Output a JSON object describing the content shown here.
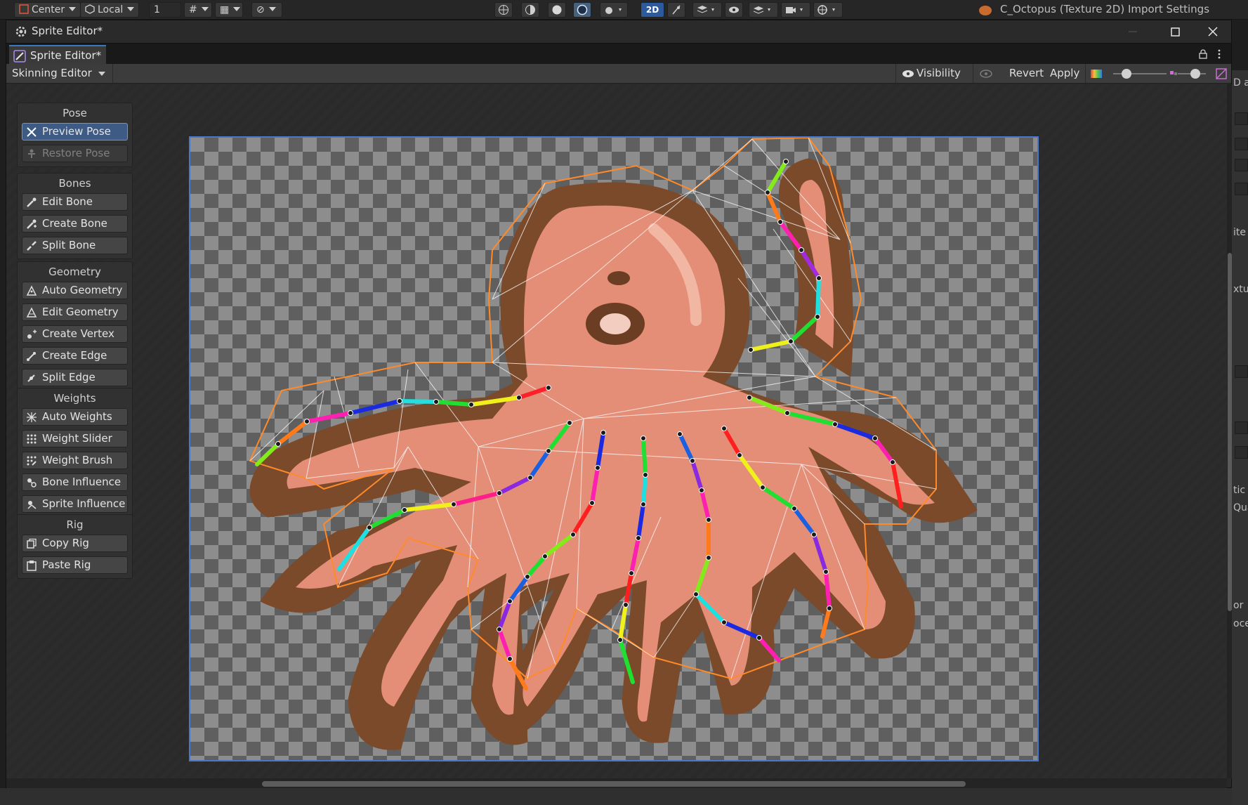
{
  "toolbar": {
    "pivot_label": "Center",
    "space_label": "Local",
    "grid_value": "1",
    "mode_2d": "2D",
    "import_title": "C_Octopus (Texture 2D) Import Settings"
  },
  "window": {
    "title": "Sprite Editor*",
    "tab_label": "Sprite Editor*",
    "mode_label": "Skinning Editor",
    "visibility_label": "Visibility",
    "revert_label": "Revert",
    "apply_label": "Apply"
  },
  "tools": {
    "pose": {
      "title": "Pose",
      "preview": "Preview Pose",
      "restore": "Restore Pose"
    },
    "bones": {
      "title": "Bones",
      "edit": "Edit Bone",
      "create": "Create Bone",
      "split": "Split Bone"
    },
    "geometry": {
      "title": "Geometry",
      "auto": "Auto Geometry",
      "edit": "Edit Geometry",
      "create_vertex": "Create Vertex",
      "create_edge": "Create Edge",
      "split_edge": "Split Edge"
    },
    "weights": {
      "title": "Weights",
      "auto": "Auto Weights",
      "slider": "Weight Slider",
      "brush": "Weight Brush",
      "bone_influence": "Bone Influence",
      "sprite_influence": "Sprite Influence"
    },
    "rig": {
      "title": "Rig",
      "copy": "Copy Rig",
      "paste": "Paste Rig"
    }
  },
  "inspector": {
    "t1": "D a",
    "t2": "ite",
    "t3": "xtur",
    "t4": "tic",
    "t5": "Qua",
    "t6": "or",
    "t7": "oce"
  },
  "colors": {
    "accent": "#3a79bb",
    "mesh_outline": "#ff8a2a",
    "octopus_body": "#e48e78",
    "octopus_rim": "#7a4a2a"
  }
}
